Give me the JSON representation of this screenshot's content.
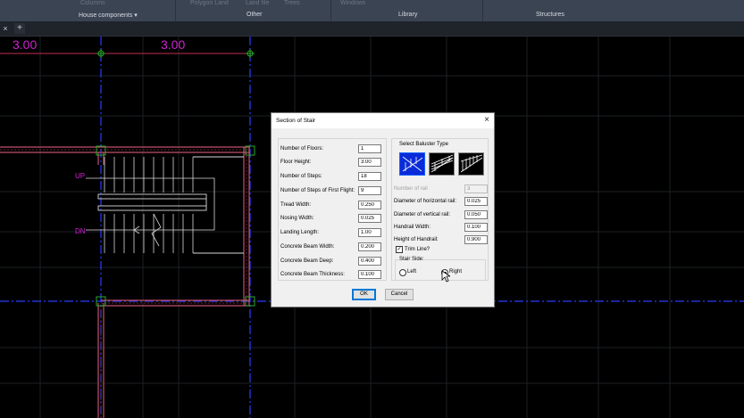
{
  "ribbon": {
    "faded": [
      "Columns",
      "Polygon Land",
      "Land file",
      "Trees",
      "Windows"
    ],
    "groups": [
      "House components ▾",
      "Other",
      "Library",
      "Structures"
    ]
  },
  "tabs": {
    "close": "×",
    "add": "+"
  },
  "drawing": {
    "dims": [
      "3.00",
      "3.00"
    ],
    "labels": [
      "UP",
      "DN"
    ],
    "colors": {
      "wall": "#c0506a",
      "dimension": "#d020d0",
      "axis": "#2a3cff",
      "grid": "#22262b",
      "stairs": "#d9d9d9",
      "node": "#2ca82c"
    }
  },
  "dialog": {
    "title": "Section of Stair",
    "close": "×",
    "fields": [
      {
        "label": "Number of Floors:",
        "value": "1"
      },
      {
        "label": "Floor Height:",
        "value": "3.00"
      },
      {
        "label": "Number of Steps:",
        "value": "18"
      },
      {
        "label": "Number of Steps of First Flight:",
        "value": "9"
      },
      {
        "label": "Tread Width:",
        "value": "0.250"
      },
      {
        "label": "Nosing Width:",
        "value": "0.025"
      },
      {
        "label": "Landing Length:",
        "value": "1.00"
      },
      {
        "label": "Concrete Beam Width:",
        "value": "0.200"
      },
      {
        "label": "Concrete Beam Deep:",
        "value": "0.400"
      },
      {
        "label": "Concrete Beam Thickness:",
        "value": "0.100"
      }
    ],
    "baluster_group": "Select Baluster Type",
    "right_fields": [
      {
        "label": "Number of rail",
        "value": "3",
        "disabled": true
      },
      {
        "label": "Diameter of horizontal rail:",
        "value": "0.025"
      },
      {
        "label": "Diameter of vertical rail:",
        "value": "0.050"
      },
      {
        "label": "Handrail Width:",
        "value": "0.100"
      },
      {
        "label": "Height of Handrail:",
        "value": "0.900"
      }
    ],
    "trim_line": "Trim Line?",
    "trim_checked": "✓",
    "stair_side": "Stair Side:",
    "left": "Left",
    "right": "Right",
    "ok": "OK",
    "cancel": "Cancel"
  }
}
